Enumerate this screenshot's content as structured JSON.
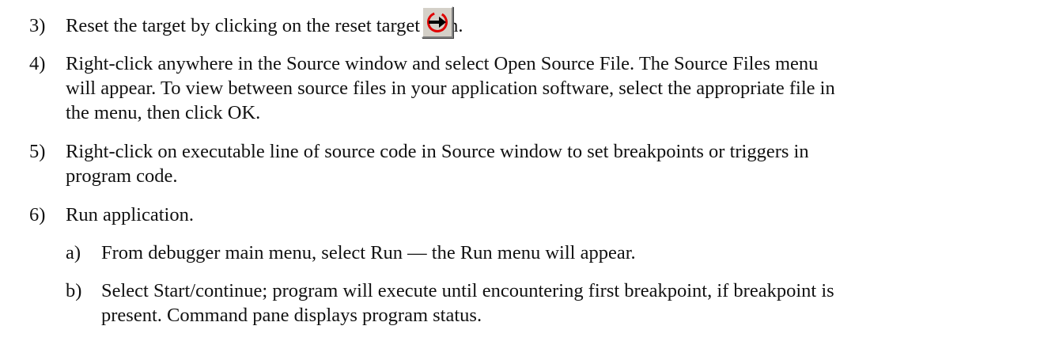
{
  "steps": [
    {
      "num": "3)",
      "lines": [
        "Reset the target by clicking on the reset target icon."
      ]
    },
    {
      "num": "4)",
      "lines": [
        "Right-click anywhere in the Source window and select Open Source File. The Source Files menu",
        "will appear. To view between source files in your application software, select the appropriate file in",
        "the menu, then click OK."
      ]
    },
    {
      "num": "5)",
      "lines": [
        "Right-click on executable line of source code in Source window to set breakpoints or triggers in",
        "program code."
      ]
    },
    {
      "num": "6)",
      "lines": [
        "Run application."
      ]
    }
  ],
  "substeps": [
    {
      "letter": "a)",
      "lines": [
        "From debugger main menu, select Run — the Run menu will appear."
      ]
    },
    {
      "letter": "b)",
      "lines": [
        "Select Start/continue; program will execute until encountering first breakpoint, if breakpoint is",
        "present. Command pane displays program status."
      ]
    }
  ],
  "icons": {
    "reset_target": "reset-target-icon"
  },
  "colors": {
    "icon_ring": "#e00000",
    "icon_arrow": "#000000",
    "button_face": "#d4d0c8"
  }
}
